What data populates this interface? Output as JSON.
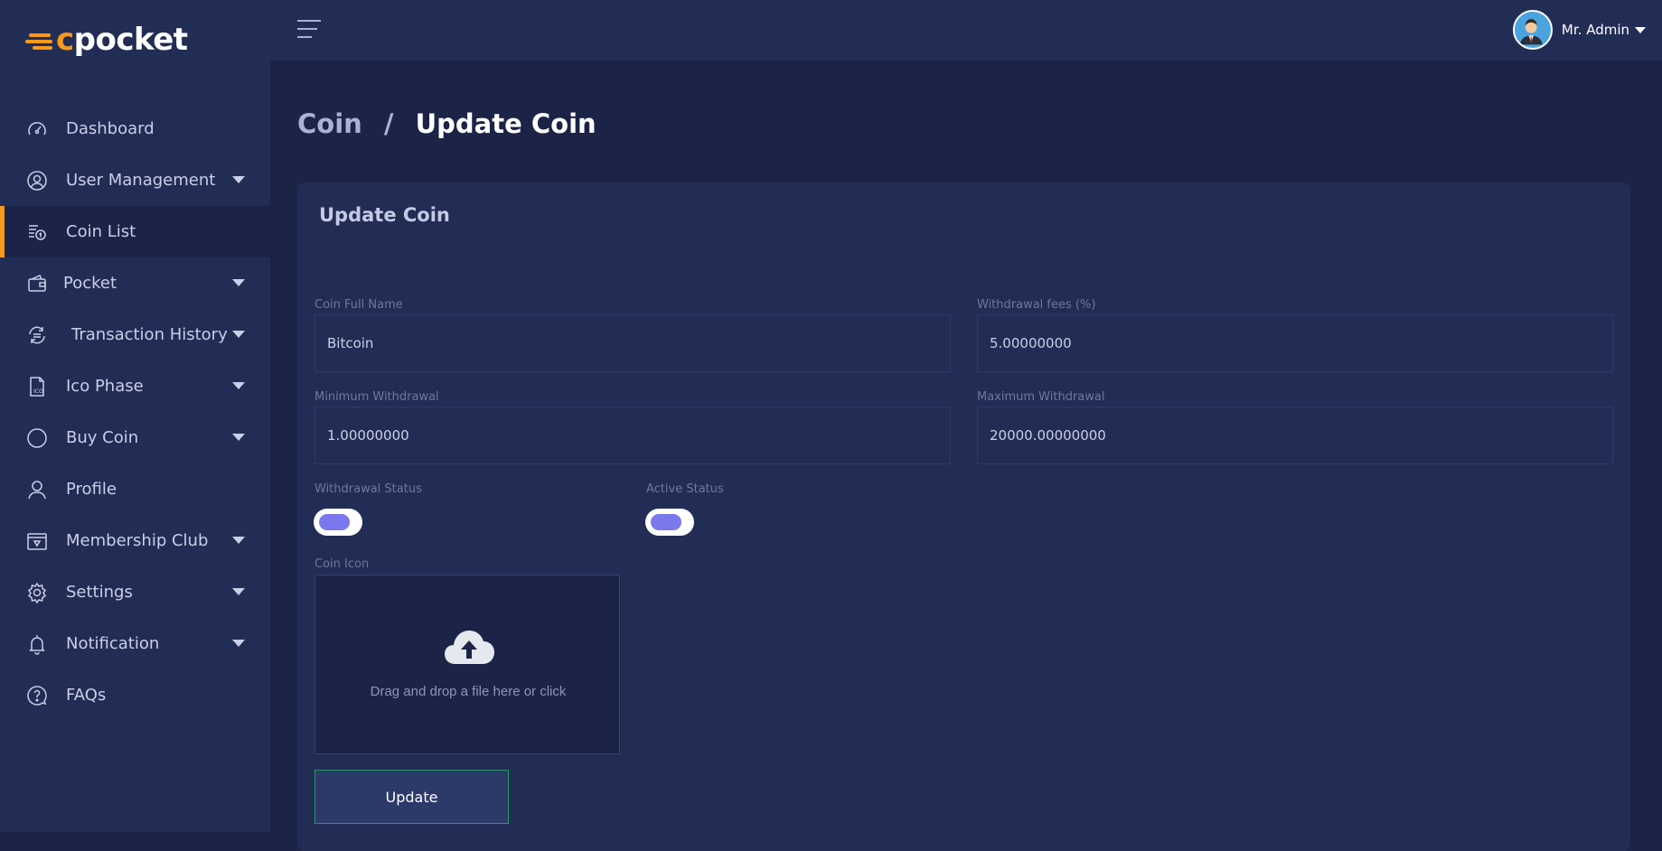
{
  "brand": {
    "logo_text": "pocket",
    "logo_letter": "c"
  },
  "sidebar": {
    "items": [
      {
        "label": "Dashboard",
        "icon": "speedometer-icon",
        "has_caret": false,
        "active": false
      },
      {
        "label": "User Management",
        "icon": "user-circle-icon",
        "has_caret": true,
        "active": false
      },
      {
        "label": "Coin List",
        "icon": "coin-list-icon",
        "has_caret": false,
        "active": true
      },
      {
        "label": "Pocket",
        "icon": "wallet-icon",
        "has_caret": true,
        "active": false
      },
      {
        "label": "Transaction History",
        "icon": "exchange-icon",
        "has_caret": true,
        "active": false
      },
      {
        "label": "Ico Phase",
        "icon": "ico-file-icon",
        "has_caret": true,
        "active": false
      },
      {
        "label": "Buy Coin",
        "icon": "circle-icon",
        "has_caret": true,
        "active": false
      },
      {
        "label": "Profile",
        "icon": "person-icon",
        "has_caret": false,
        "active": false
      },
      {
        "label": "Membership Club",
        "icon": "membership-card-icon",
        "has_caret": true,
        "active": false
      },
      {
        "label": "Settings",
        "icon": "gear-icon",
        "has_caret": true,
        "active": false
      },
      {
        "label": "Notification",
        "icon": "bell-icon",
        "has_caret": true,
        "active": false
      },
      {
        "label": "FAQs",
        "icon": "question-bubble-icon",
        "has_caret": false,
        "active": false
      }
    ]
  },
  "header": {
    "user_name": "Mr. Admin"
  },
  "breadcrumb": {
    "parent": "Coin",
    "separator": "/",
    "current": "Update Coin"
  },
  "form": {
    "title": "Update Coin",
    "coin_full_name": {
      "label": "Coin Full Name",
      "value": "Bitcoin"
    },
    "withdrawal_fees": {
      "label": "Withdrawal fees (%)",
      "value": "5.00000000"
    },
    "minimum_withdrawal": {
      "label": "Minimum Withdrawal",
      "value": "1.00000000"
    },
    "maximum_withdrawal": {
      "label": "Maximum Withdrawal",
      "value": "20000.00000000"
    },
    "withdrawal_status": {
      "label": "Withdrawal Status"
    },
    "active_status": {
      "label": "Active Status"
    },
    "coin_icon": {
      "label": "Coin Icon",
      "dropzone_text": "Drag and drop a file here or click"
    },
    "submit_label": "Update"
  },
  "colors": {
    "accent": "#f59a1d",
    "sidebar_bg": "#222d56",
    "page_bg": "#1b2447",
    "toggle_knob": "#7b78ee",
    "button_border": "#1e9e5f"
  }
}
